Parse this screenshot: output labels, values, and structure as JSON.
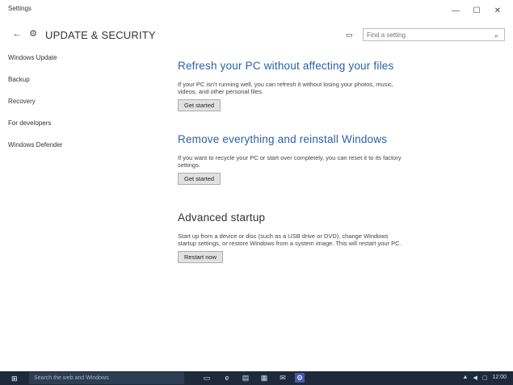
{
  "window": {
    "title": "Settings",
    "controls": {
      "minimize": "—",
      "maximize": "☐",
      "close": "✕"
    }
  },
  "header": {
    "back_glyph": "←",
    "home_glyph": "⚙",
    "title": "UPDATE & SECURITY",
    "search_placeholder": "Find a setting"
  },
  "sidebar": {
    "items": [
      {
        "label": "Windows Update"
      },
      {
        "label": "Backup"
      },
      {
        "label": "Recovery"
      },
      {
        "label": "For developers"
      },
      {
        "label": "Windows Defender"
      }
    ]
  },
  "main": {
    "sections": [
      {
        "heading": "Refresh your PC without affecting your files",
        "description": "If your PC isn't running well, you can refresh it without losing your photos, music, videos, and other personal files.",
        "button": "Get started"
      },
      {
        "heading": "Remove everything and reinstall Windows",
        "description": "If you want to recycle your PC or start over completely, you can reset it to its factory settings.",
        "button": "Get started"
      },
      {
        "heading": "Advanced startup",
        "description": "Start up from a device or disc (such as a USB drive or DVD), change Windows startup settings, or restore Windows from a system image. This will restart your PC.",
        "button": "Restart now"
      }
    ]
  },
  "taskbar": {
    "start_glyph": "⊞",
    "search_placeholder": "Search the web and Windows",
    "tray_time": "12:00"
  },
  "colors": {
    "accent": "#2b5fa8",
    "taskbar": "#1c2a3c"
  }
}
